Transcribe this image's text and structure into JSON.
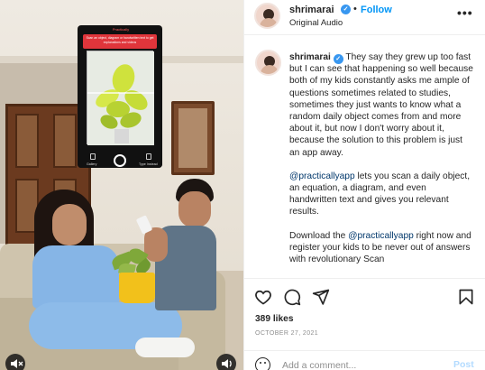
{
  "video": {
    "phone_brand": "Practically",
    "phone_banner": "Scan an object, diagram or handwritten text to get explanations and videos",
    "phone_left_label": "Gallery",
    "phone_right_label": "Type Instead",
    "mute_icon": "mute-icon",
    "sound_icon": "speaker-icon"
  },
  "header": {
    "username": "shrimarai",
    "verified_icon": "verified-badge-icon",
    "separator": "•",
    "follow_label": "Follow",
    "audio_label": "Original Audio",
    "more_icon": "more-options-icon",
    "more_glyph": "•••"
  },
  "caption": {
    "username": "shrimarai",
    "paragraph1": "They say they grew up too fast but I can see that happening so well because both of my kids constantly asks me ample of questions sometimes related to studies, sometimes they just wants to know what a random daily object comes from and more about it, but now I don't worry about it, because the solution to this problem is just an app away.",
    "p2_mention": "@practicallyapp",
    "p2_rest": " lets you scan a daily object, an equation, a diagram, and even handwritten text and gives you relevant results.",
    "p3_start": "Download the ",
    "p3_mention": "@practicallyapp",
    "p3_rest": " right now and register your kids to be never out of answers with revolutionary Scan"
  },
  "actions": {
    "like_icon": "heart-icon",
    "comment_icon": "comment-icon",
    "share_icon": "share-icon",
    "save_icon": "bookmark-icon"
  },
  "likes": "389 likes",
  "date": "OCTOBER 27, 2021",
  "comment_box": {
    "emoji_icon": "emoji-icon",
    "placeholder": "Add a comment...",
    "post_label": "Post"
  },
  "colors": {
    "accent": "#0095f6",
    "verified": "#3897f0",
    "mention": "#00376b",
    "post_disabled": "#b3dbff",
    "muted_text": "#8e8e8e"
  }
}
